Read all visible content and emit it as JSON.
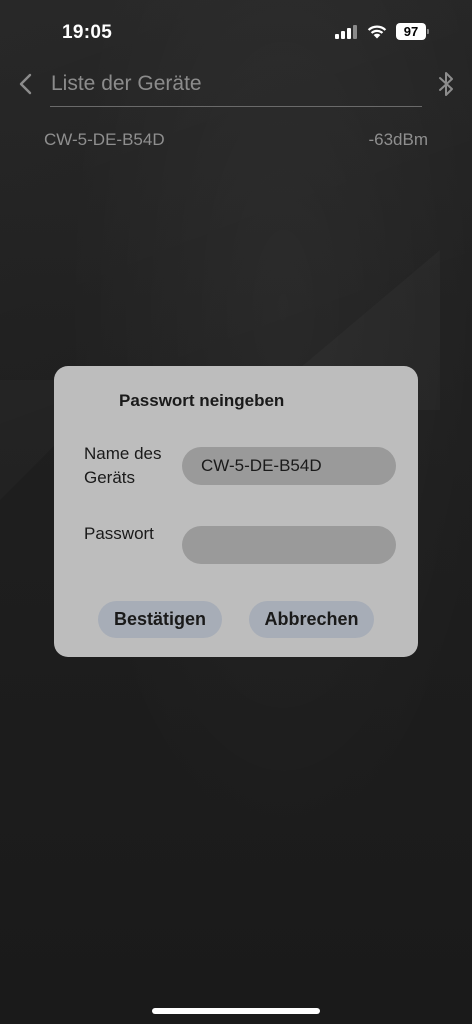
{
  "status_bar": {
    "time": "19:05",
    "battery": "97"
  },
  "header": {
    "title": "Liste der Geräte",
    "back_icon": "chevron-left-icon",
    "bluetooth_icon": "bluetooth-icon"
  },
  "devices": [
    {
      "name": "CW-5-DE-B54D",
      "rssi": "-63dBm"
    }
  ],
  "dialog": {
    "title": "Passwort neingeben",
    "name_label": "Name des Geräts",
    "name_value": "CW-5-DE-B54D",
    "password_label": "Passwort",
    "password_value": "",
    "confirm_label": "Bestätigen",
    "cancel_label": "Abbrechen"
  },
  "colors": {
    "background": "#1f1f1f",
    "dialog": "#bdbdbd",
    "button": "#a7adb7"
  }
}
